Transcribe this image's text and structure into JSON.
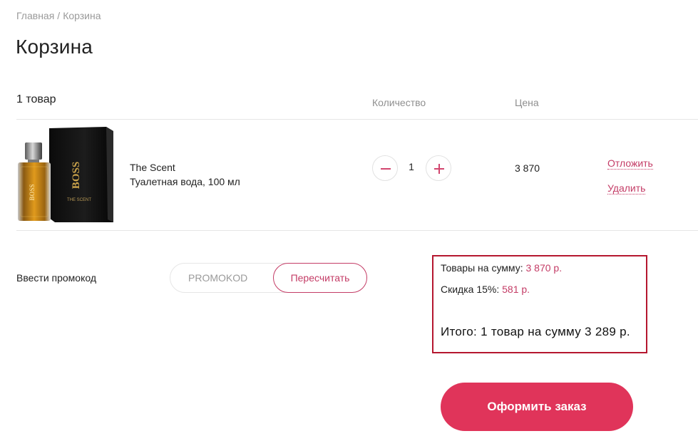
{
  "breadcrumb": {
    "home": "Главная",
    "separator": "/",
    "current": "Корзина"
  },
  "page": {
    "title": "Корзина"
  },
  "cart": {
    "count_label": "1 товар",
    "columns": {
      "quantity": "Количество",
      "price": "Цена"
    },
    "items": [
      {
        "image_icon": "perfume-bottle-and-box",
        "box_brand_text": "BOSS",
        "box_product_text": "THE SCENT",
        "name": "The Scent",
        "description": "Туалетная вода, 100 мл",
        "quantity": "1",
        "price": "3 870",
        "actions": {
          "later": "Отложить",
          "remove": "Удалить"
        }
      }
    ]
  },
  "promo": {
    "label": "Ввести промокод",
    "placeholder": "PROMOKOD",
    "recalc_label": "Пересчитать"
  },
  "summary": {
    "goods_label": "Товары на сумму:",
    "goods_value": "3 870 р.",
    "discount_label": "Скидка 15%:",
    "discount_value": "581 р.",
    "total": "Итого: 1 товар на сумму 3 289 р."
  },
  "checkout": {
    "label": "Оформить заказ"
  },
  "colors": {
    "accent": "#c43c66",
    "checkout": "#e0345a",
    "summary_border": "#b5172f"
  }
}
